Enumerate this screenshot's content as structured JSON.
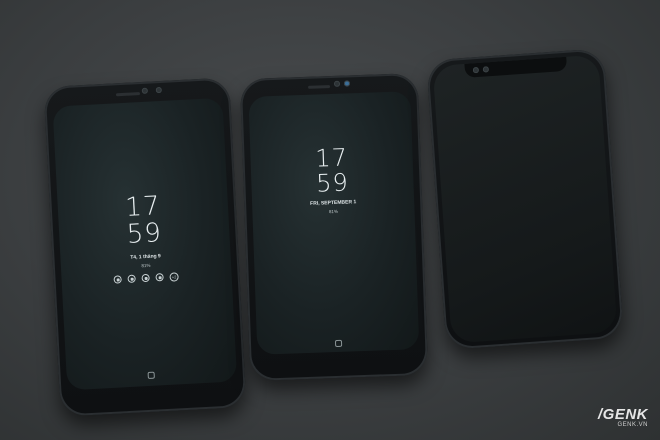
{
  "phones": [
    {
      "clock_hour": "17",
      "clock_minute": "59",
      "date": "T4, 1 tháng 9",
      "battery": "81%",
      "notifications": [
        "notification-icon",
        "notification-icon",
        "notification-icon",
        "notification-icon"
      ],
      "more_count": "+2"
    },
    {
      "clock_hour": "17",
      "clock_minute": "59",
      "date": "FRI, SEPTEMBER 1",
      "battery": "81%"
    },
    {
      "screen_on": false
    }
  ],
  "watermark": {
    "logo": "/GENK",
    "url": "GENK.VN"
  }
}
